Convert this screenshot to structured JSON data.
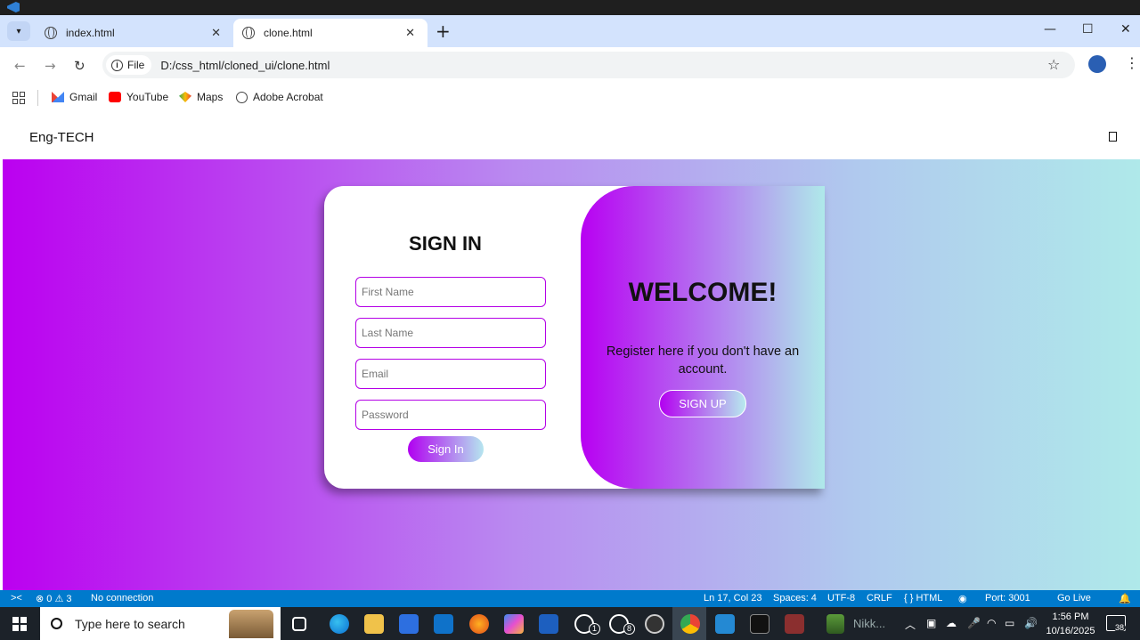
{
  "browser": {
    "tabs": [
      {
        "label": "index.html",
        "active": false
      },
      {
        "label": "clone.html",
        "active": true
      }
    ],
    "address": {
      "scheme_label": "File",
      "url": "D:/css_html/cloned_ui/clone.html"
    },
    "bookmarks": [
      {
        "label": "Gmail",
        "icon": "gmail-icon"
      },
      {
        "label": "YouTube",
        "icon": "youtube-icon"
      },
      {
        "label": "Maps",
        "icon": "maps-icon"
      },
      {
        "label": "Adobe Acrobat",
        "icon": "globe-icon"
      }
    ]
  },
  "site": {
    "brand": "Eng-TECH",
    "signin": {
      "title": "SIGN IN",
      "fields": [
        {
          "placeholder": "First Name"
        },
        {
          "placeholder": "Last Name"
        },
        {
          "placeholder": "Email"
        },
        {
          "placeholder": "Password"
        }
      ],
      "button": "Sign In"
    },
    "welcome": {
      "title": "WELCOME!",
      "text": "Register here if you don't have an account.",
      "button": "SIGN UP"
    },
    "colors": {
      "accent_purple": "#b400e6",
      "gradient_end": "#afe9ea"
    }
  },
  "vscode_status": {
    "problems": "⊗ 0 ⚠ 3",
    "connection": "No connection",
    "cursor": "Ln 17, Col 23",
    "spaces": "Spaces: 4",
    "encoding": "UTF-8",
    "eol": "CRLF",
    "language": "{ } HTML",
    "port": "Port: 3001",
    "golive": "Go Live"
  },
  "taskbar": {
    "search_placeholder": "Type here to search",
    "whatsapp_badge_1": "1",
    "whatsapp_badge_2": "8",
    "nikk_label": "Nikk...",
    "time": "1:56 PM",
    "date": "10/16/2025",
    "notifications": "38"
  }
}
